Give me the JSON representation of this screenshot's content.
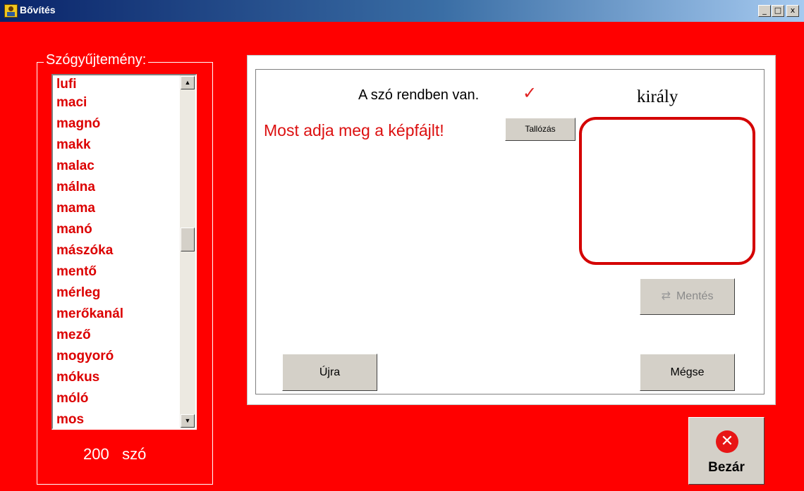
{
  "window": {
    "title": "Bővítés",
    "minimize_glyph": "_",
    "maximize_glyph": "□",
    "close_glyph": "x"
  },
  "wordlist": {
    "label": "Szógyűjtemény:",
    "items": [
      "lufi",
      "maci",
      "magnó",
      "makk",
      "malac",
      "málna",
      "mama",
      "manó",
      "mászóka",
      "mentő",
      "mérleg",
      "merőkanál",
      "mező",
      "mogyoró",
      "mókus",
      "móló",
      "mos"
    ],
    "count_value": "200",
    "count_unit": "szó"
  },
  "editor": {
    "status_text": "A szó rendben van.",
    "status_check": "✓",
    "current_word": "király",
    "prompt": "Most adja meg a képfájlt!",
    "browse_label": "Tallózás",
    "save_label": "Mentés",
    "again_label": "Újra",
    "cancel_label": "Mégse"
  },
  "close_button": {
    "label": "Bezár",
    "icon_glyph": "✕"
  },
  "colors": {
    "background": "#ff0000",
    "accent_text": "#dc0000"
  }
}
